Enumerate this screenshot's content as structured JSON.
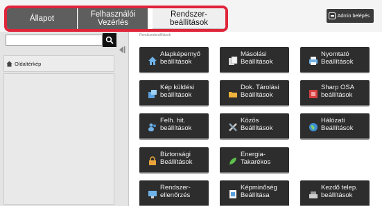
{
  "tabs": [
    {
      "label": "Állapot"
    },
    {
      "label": "Felhasználói\nVezérlés"
    },
    {
      "label": "Rendszer-\nbeállítások"
    }
  ],
  "admin": {
    "label": "Admin belépés"
  },
  "sidebar": {
    "sitemap_label": "Oldaltérkép"
  },
  "main": {
    "breadcrumb": "Rendszerbeállítások"
  },
  "tiles": [
    {
      "label": "Alapképernyő\nbeállítások",
      "icon": "home-icon"
    },
    {
      "label": "Másolási\nBeállítások",
      "icon": "copy-icon"
    },
    {
      "label": "Nyomtató\nBeállítások",
      "icon": "printer-icon"
    },
    {
      "label": "Kép küldési\nbeállítások",
      "icon": "image-send-icon"
    },
    {
      "label": "Dok. Tárolási\nBeállítások",
      "icon": "folder-icon"
    },
    {
      "label": "Sharp OSA\nbeállítások",
      "icon": "osa-icon"
    },
    {
      "label": "Felh. hit.\nbeállítások",
      "icon": "users-icon"
    },
    {
      "label": "Közös\nBeállítások",
      "icon": "tools-icon"
    },
    {
      "label": "Hálózati\nBeállítások",
      "icon": "globe-icon"
    },
    {
      "label": "Biztonsági\nBeállítások",
      "icon": "lock-icon"
    },
    {
      "label": "Energia-\nTakarékos",
      "icon": "leaf-icon"
    },
    {
      "label": "Rendszer-\nellenőrzés",
      "icon": "monitor-icon"
    },
    {
      "label": "Képminőség\nBeállítása",
      "icon": "image-quality-icon"
    },
    {
      "label": "Kezdő telep.\nbeállítások",
      "icon": "setup-icon"
    }
  ]
}
